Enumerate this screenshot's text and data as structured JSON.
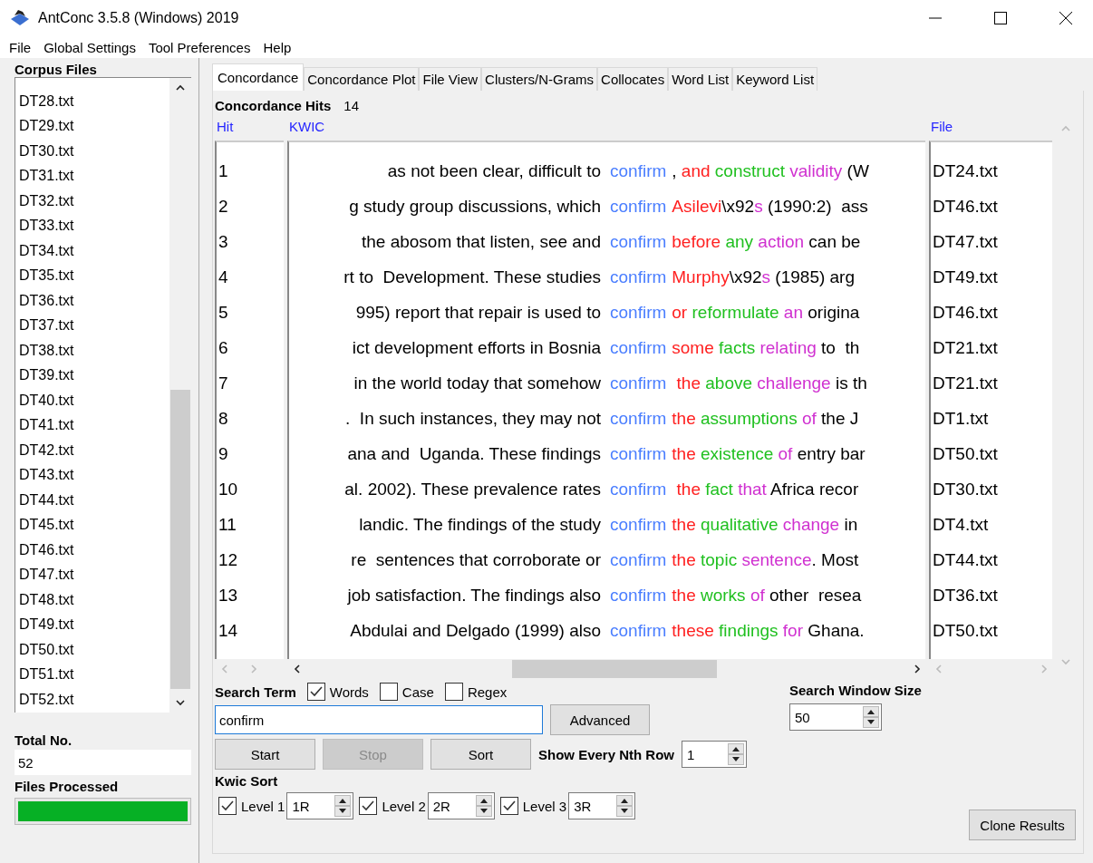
{
  "window": {
    "title": "AntConc 3.5.8 (Windows) 2019"
  },
  "menu": [
    "File",
    "Global Settings",
    "Tool Preferences",
    "Help"
  ],
  "corpus_files": {
    "label": "Corpus Files",
    "files": [
      "DT28.txt",
      "DT29.txt",
      "DT30.txt",
      "DT31.txt",
      "DT32.txt",
      "DT33.txt",
      "DT34.txt",
      "DT35.txt",
      "DT36.txt",
      "DT37.txt",
      "DT38.txt",
      "DT39.txt",
      "DT40.txt",
      "DT41.txt",
      "DT42.txt",
      "DT43.txt",
      "DT44.txt",
      "DT45.txt",
      "DT46.txt",
      "DT47.txt",
      "DT48.txt",
      "DT49.txt",
      "DT50.txt",
      "DT51.txt",
      "DT52.txt"
    ]
  },
  "total": {
    "label": "Total No.",
    "value": "52"
  },
  "files_processed": {
    "label": "Files Processed",
    "level": 1
  },
  "tabs": [
    {
      "label": "Concordance",
      "selected": true
    },
    {
      "label": "Concordance Plot",
      "selected": false
    },
    {
      "label": "File View",
      "selected": false
    },
    {
      "label": "Clusters/N-Grams",
      "selected": false
    },
    {
      "label": "Collocates",
      "selected": false
    },
    {
      "label": "Word List",
      "selected": false
    },
    {
      "label": "Keyword List",
      "selected": false
    }
  ],
  "hits": {
    "label": "Concordance Hits",
    "count": "14"
  },
  "table": {
    "columns": [
      "Hit",
      "KWIC",
      "File"
    ],
    "rows": [
      {
        "hit": "1",
        "left": "as not been clear, difficult to",
        "keyword": "confirm",
        "right": [
          {
            "text": ","
          },
          {
            "text": " and",
            "color": "#ff2020"
          },
          {
            "text": " construct",
            "color": "#20c020"
          },
          {
            "text": " validity",
            "color": "#d030d0"
          },
          {
            "text": " (W"
          }
        ],
        "file": "DT24.txt"
      },
      {
        "hit": "2",
        "left": "g study group discussions, which",
        "keyword": "confirm",
        "right": [
          {
            "text": "Asilevi",
            "color": "#ff2020"
          },
          {
            "text": "\\x92"
          },
          {
            "text": "s",
            "color": "#d030d0"
          },
          {
            "text": " (1990:2)  ass"
          }
        ],
        "file": "DT46.txt"
      },
      {
        "hit": "3",
        "left": "the abosom that listen, see and",
        "keyword": "confirm",
        "right": [
          {
            "text": "before",
            "color": "#ff2020"
          },
          {
            "text": " any",
            "color": "#20c020"
          },
          {
            "text": " action",
            "color": "#d030d0"
          },
          {
            "text": " can be"
          }
        ],
        "file": "DT47.txt"
      },
      {
        "hit": "4",
        "left": "rt to  Development. These studies",
        "keyword": "confirm",
        "right": [
          {
            "text": "Murphy",
            "color": "#ff2020"
          },
          {
            "text": "\\x92"
          },
          {
            "text": "s",
            "color": "#d030d0"
          },
          {
            "text": " (1985) arg"
          }
        ],
        "file": "DT49.txt"
      },
      {
        "hit": "5",
        "left": "995) report that repair is used to",
        "keyword": "confirm",
        "right": [
          {
            "text": "or",
            "color": "#ff2020"
          },
          {
            "text": " reformulate",
            "color": "#20c020"
          },
          {
            "text": " an",
            "color": "#d030d0"
          },
          {
            "text": " origina"
          }
        ],
        "file": "DT46.txt"
      },
      {
        "hit": "6",
        "left": "ict development efforts in Bosnia",
        "keyword": "confirm",
        "right": [
          {
            "text": "some",
            "color": "#ff2020"
          },
          {
            "text": " facts",
            "color": "#20c020"
          },
          {
            "text": " relating",
            "color": "#d030d0"
          },
          {
            "text": " to  th"
          }
        ],
        "file": "DT21.txt"
      },
      {
        "hit": "7",
        "left": "in the world today that somehow",
        "keyword": "confirm",
        "right": [
          {
            "text": " the",
            "color": "#ff2020"
          },
          {
            "text": " above",
            "color": "#20c020"
          },
          {
            "text": " challenge",
            "color": "#d030d0"
          },
          {
            "text": " is th"
          }
        ],
        "file": "DT21.txt"
      },
      {
        "hit": "8",
        "left": ".  In such instances, they may not",
        "keyword": "confirm",
        "right": [
          {
            "text": "the",
            "color": "#ff2020"
          },
          {
            "text": " assumptions",
            "color": "#20c020"
          },
          {
            "text": " of",
            "color": "#d030d0"
          },
          {
            "text": " the J"
          }
        ],
        "file": "DT1.txt"
      },
      {
        "hit": "9",
        "left": "ana and  Uganda. These findings",
        "keyword": "confirm",
        "right": [
          {
            "text": "the",
            "color": "#ff2020"
          },
          {
            "text": " existence",
            "color": "#20c020"
          },
          {
            "text": " of",
            "color": "#d030d0"
          },
          {
            "text": " entry bar"
          }
        ],
        "file": "DT50.txt"
      },
      {
        "hit": "10",
        "left": "al. 2002). These prevalence rates",
        "keyword": "confirm",
        "right": [
          {
            "text": " the",
            "color": "#ff2020"
          },
          {
            "text": " fact",
            "color": "#20c020"
          },
          {
            "text": " that",
            "color": "#d030d0"
          },
          {
            "text": " Africa recor"
          }
        ],
        "file": "DT30.txt"
      },
      {
        "hit": "11",
        "left": "landic. The findings of the study",
        "keyword": "confirm",
        "right": [
          {
            "text": "the",
            "color": "#ff2020"
          },
          {
            "text": " qualitative",
            "color": "#20c020"
          },
          {
            "text": " change",
            "color": "#d030d0"
          },
          {
            "text": " in"
          }
        ],
        "file": "DT4.txt"
      },
      {
        "hit": "12",
        "left": "re  sentences that corroborate or",
        "keyword": "confirm",
        "right": [
          {
            "text": "the",
            "color": "#ff2020"
          },
          {
            "text": " topic",
            "color": "#20c020"
          },
          {
            "text": " sentence",
            "color": "#d030d0"
          },
          {
            "text": ". Most"
          }
        ],
        "file": "DT44.txt"
      },
      {
        "hit": "13",
        "left": "job satisfaction. The findings also",
        "keyword": "confirm",
        "right": [
          {
            "text": "the",
            "color": "#ff2020"
          },
          {
            "text": " works",
            "color": "#20c020"
          },
          {
            "text": " of",
            "color": "#d030d0"
          },
          {
            "text": " other  resea"
          }
        ],
        "file": "DT36.txt"
      },
      {
        "hit": "14",
        "left": "Abdulai and Delgado (1999) also",
        "keyword": "confirm",
        "right": [
          {
            "text": "these",
            "color": "#ff2020"
          },
          {
            "text": " findings",
            "color": "#20c020"
          },
          {
            "text": " for",
            "color": "#d030d0"
          },
          {
            "text": " Ghana."
          }
        ],
        "file": "DT50.txt"
      }
    ]
  },
  "search": {
    "label": "Search Term",
    "options": [
      {
        "label": "Words",
        "checked": true
      },
      {
        "label": "Case",
        "checked": false
      },
      {
        "label": "Regex",
        "checked": false
      }
    ],
    "value": "confirm",
    "advanced": "Advanced"
  },
  "buttons": [
    {
      "label": "Start",
      "disabled": false
    },
    {
      "label": "Stop",
      "disabled": true
    },
    {
      "label": "Sort",
      "disabled": false
    }
  ],
  "nth_row": {
    "label": "Show Every Nth Row",
    "value": "1"
  },
  "window_size": {
    "label": "Search Window Size",
    "value": "50"
  },
  "kwic_sort": {
    "label": "Kwic Sort",
    "levels": [
      {
        "label": "Level 1",
        "checked": true,
        "value": "1R"
      },
      {
        "label": "Level 2",
        "checked": true,
        "value": "2R"
      },
      {
        "label": "Level 3",
        "checked": true,
        "value": "3R"
      }
    ]
  },
  "clone": "Clone Results"
}
